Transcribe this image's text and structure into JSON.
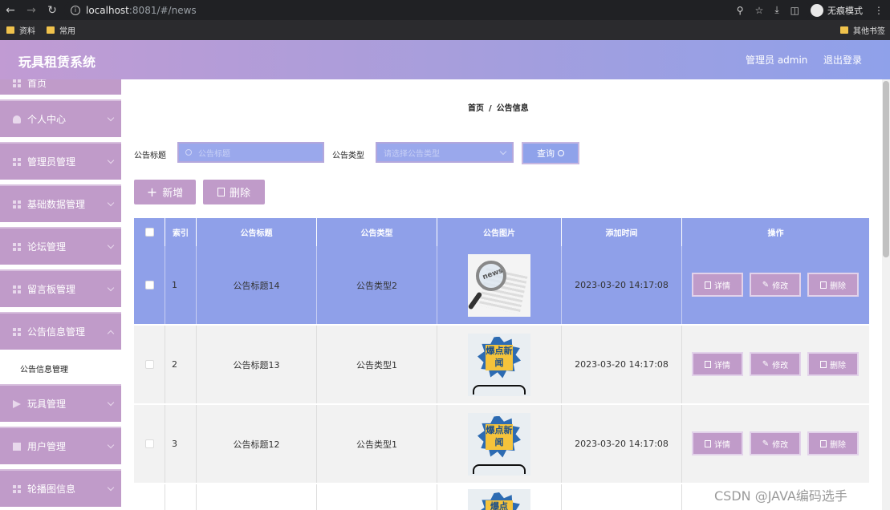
{
  "browser": {
    "url_host": "localhost",
    "url_port_path": ":8081/#/news",
    "incognito_label": "无痕模式",
    "bookmarks": [
      {
        "label": "资料"
      },
      {
        "label": "常用"
      }
    ],
    "other_bookmarks": "其他书签"
  },
  "header": {
    "title": "玩具租赁系统",
    "user": "管理员 admin",
    "logout": "退出登录",
    "gradient_colors": [
      "#c19bd3",
      "#8fa1ea"
    ]
  },
  "sidebar": {
    "partial_top": "首页",
    "items": [
      {
        "label": "个人中心",
        "icon": "person-icon"
      },
      {
        "label": "管理员管理",
        "icon": "grid-icon"
      },
      {
        "label": "基础数据管理",
        "icon": "grid-icon"
      },
      {
        "label": "论坛管理",
        "icon": "grid-icon"
      },
      {
        "label": "留言板管理",
        "icon": "grid-icon"
      },
      {
        "label": "公告信息管理",
        "icon": "grid-icon"
      },
      {
        "label": "玩具管理",
        "icon": "plane-icon"
      },
      {
        "label": "用户管理",
        "icon": "box-icon"
      },
      {
        "label": "轮播图信息",
        "icon": "grid-icon"
      }
    ],
    "active_sub": "公告信息管理",
    "item_color": "#c09bc9"
  },
  "breadcrumb": {
    "home": "首页",
    "sep": "/",
    "current": "公告信息"
  },
  "search": {
    "title_label": "公告标题",
    "title_placeholder": "公告标题",
    "type_label": "公告类型",
    "type_placeholder": "请选择公告类型",
    "query_button": "查询"
  },
  "actions": {
    "add": "新增",
    "delete": "删除"
  },
  "table": {
    "columns": [
      "索引",
      "公告标题",
      "公告类型",
      "公告图片",
      "添加时间",
      "操作"
    ],
    "rows": [
      {
        "index": "1",
        "title": "公告标题14",
        "type": "公告类型2",
        "image": "news-magnifier",
        "time": "2023-03-20 14:17:08",
        "selected": true
      },
      {
        "index": "2",
        "title": "公告标题13",
        "type": "公告类型1",
        "image": "news-burst",
        "burst_text": "爆点新闻",
        "time": "2023-03-20 14:17:08",
        "selected": false
      },
      {
        "index": "3",
        "title": "公告标题12",
        "type": "公告类型1",
        "image": "news-burst",
        "burst_text": "爆点新闻",
        "time": "2023-03-20 14:17:08",
        "selected": false
      }
    ],
    "row_buttons": {
      "detail": "详情",
      "edit": "修改",
      "delete": "删除"
    },
    "partial_row_burst": "爆点"
  },
  "watermark": "CSDN @JAVA编码选手"
}
